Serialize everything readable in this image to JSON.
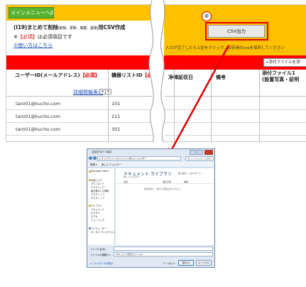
{
  "left_sheet": {
    "menu_back_button": "メインメニューへ戻る",
    "title_main": "(I19)まとめて削除",
    "title_small": "(削除、更新、廃棄、譲渡)",
    "title_tail": "用CSV作成",
    "required_note_prefix": "※",
    "required_note_mark": "【必須】",
    "required_note_suffix": "は必須項目です",
    "howto_link": "①使い方はこちら",
    "header_user_id": "ユーザーID(メールアドレス)",
    "header_required": "【必須】",
    "header_equipment_list_id": "機器リストID",
    "header_equipment_required": "【必",
    "detail_link": "詳細情報表示",
    "dropdown_glyph": "▾",
    "rows": [
      {
        "email": "taro01@kucho.com",
        "id": "101"
      },
      {
        "email": "taro01@kucho.com",
        "id": "211"
      },
      {
        "email": "taro01@kucho.com",
        "id": "301"
      }
    ]
  },
  "right_sheet": {
    "step_number": "⑧",
    "csv_button": "CSV出力",
    "instruction": "入力が完了したら上記をクリック、保存用のcsvを保存してください",
    "attach_button": "+添付ファイルを添",
    "header_date": "净韓証収日",
    "header_notes": "備考",
    "header_attach_line1": "添付ファイル1",
    "header_attach_line2": "(設置写真・証明"
  },
  "save_dialog": {
    "title": "名前を付けて保存",
    "address_path": "▸ ライブラリ ▸ ドキュメント ▸ 新しいフォルダー",
    "search_placeholder": "新しいフォルダーの検索",
    "toolbar_organize": "整理 ▾",
    "toolbar_new_folder": "新しいフォルダー",
    "nav_items": [
      "Microsoft Office",
      "",
      "お気に入り",
      "ダウンロード",
      "デスクトップ",
      "最近表示した場所",
      "デスクトップ",
      "デスクトップ",
      "",
      "ライブラリ",
      "ドキュメント",
      "ピクチャ",
      "ビデオ",
      "ミュージック",
      "",
      "コンピューター",
      "ローカル ディスク (C:)"
    ],
    "library_title": "ドキュメント ライブラリ",
    "library_subtitle": "新しいフォルダー",
    "arrange_label": "並べ替え: フォルダー ▾",
    "col_name": "名前",
    "col_date": "更新日時",
    "col_type": "種類",
    "empty_message": "検索条件に一致する項目はありません。",
    "filename_label": "ファイル名(N):",
    "filename_value": "",
    "filetype_label": "ファイルの種類(T):",
    "filetype_value": "CSV (コンマ区切り) (*.csv)",
    "hide_folders": "▴ フォルダーの非表示",
    "tools_label": "ツール(L) ▾",
    "save_button": "保存(S)",
    "cancel_button": "キャンセル"
  },
  "colors": {
    "banner_yellow": "#ffc000",
    "header_red": "#ff0000",
    "menu_button_green": "#58b232",
    "highlight_red": "#e00000",
    "link_blue": "#1f4fbf",
    "arrow_red": "#e00000"
  }
}
